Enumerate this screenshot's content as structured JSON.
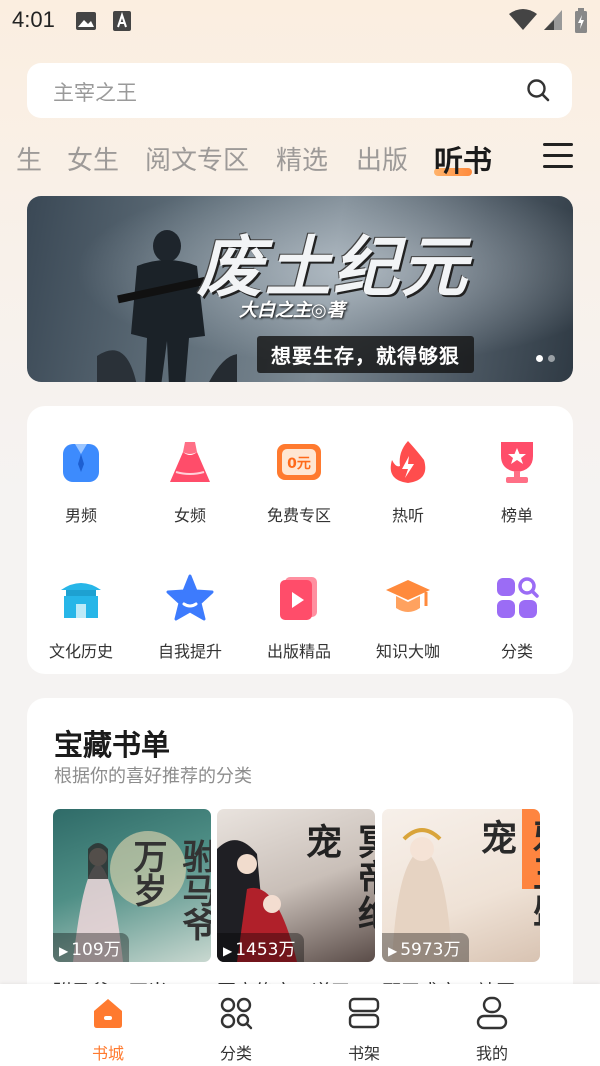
{
  "status_bar": {
    "time": "4:01"
  },
  "search": {
    "placeholder": "主宰之王"
  },
  "tabs": [
    {
      "label": "生"
    },
    {
      "label": "女生"
    },
    {
      "label": "阅文专区"
    },
    {
      "label": "精选"
    },
    {
      "label": "出版"
    },
    {
      "label": "听书",
      "active": true
    }
  ],
  "banner": {
    "title": "废土纪元",
    "author": "大白之主◎著",
    "slogan": "想要生存，就得够狠"
  },
  "categories": [
    {
      "label": "男频",
      "icon": "shirt-icon",
      "color": "#3d8bfd"
    },
    {
      "label": "女频",
      "icon": "dress-icon",
      "color": "#ff4d6a"
    },
    {
      "label": "免费专区",
      "icon": "free-ticket-icon",
      "color": "#ff7a2f",
      "badge": "0元"
    },
    {
      "label": "热听",
      "icon": "flame-icon",
      "color": "#ff4d4d"
    },
    {
      "label": "榜单",
      "icon": "trophy-icon",
      "color": "#ff4d6a"
    },
    {
      "label": "文化历史",
      "icon": "pavilion-icon",
      "color": "#27b6e8"
    },
    {
      "label": "自我提升",
      "icon": "star-icon",
      "color": "#3d7bfd"
    },
    {
      "label": "出版精品",
      "icon": "play-book-icon",
      "color": "#ff4d6a"
    },
    {
      "label": "知识大咖",
      "icon": "graduation-cap-icon",
      "color": "#ff8a3c"
    },
    {
      "label": "分类",
      "icon": "grid-search-icon",
      "color": "#9b6cf5"
    }
  ],
  "treasure": {
    "title": "宝藏书单",
    "subtitle": "根据你的喜好推荐的分类",
    "books": [
      {
        "count": "109万",
        "caption": "驸马爷，不当",
        "cover_title": "驸马爷万岁"
      },
      {
        "count": "1453万",
        "caption": "冥帝绝宠：逆天",
        "cover_title": "冥帝绝宠"
      },
      {
        "count": "5973万",
        "caption": "邪王盛宠：神医",
        "cover_title": "邪王盛宠"
      }
    ]
  },
  "bottom_nav": [
    {
      "label": "书城",
      "icon": "home-icon",
      "active": true
    },
    {
      "label": "分类",
      "icon": "category-icon"
    },
    {
      "label": "书架",
      "icon": "bookshelf-icon"
    },
    {
      "label": "我的",
      "icon": "profile-icon"
    }
  ],
  "colors": {
    "accent": "#ff7a2f",
    "page_bg": "#f5f3f2"
  }
}
